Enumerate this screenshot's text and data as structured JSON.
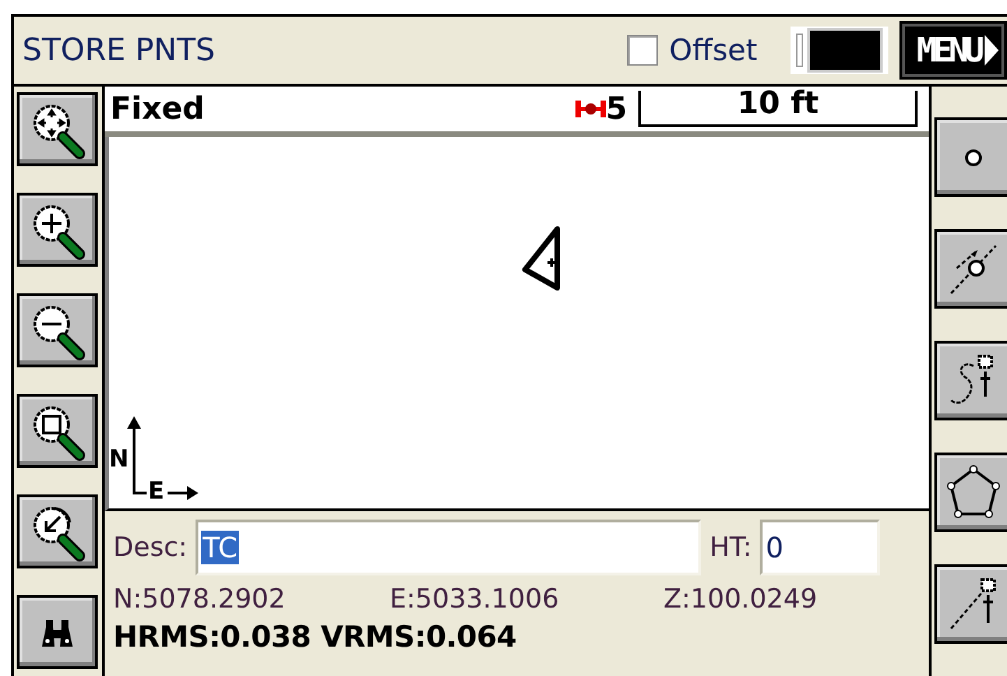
{
  "title": "STORE PNTS",
  "offset": {
    "label": "Offset",
    "checked": false
  },
  "menu_button": "MENU",
  "status": {
    "mode": "Fixed",
    "satellites": "5",
    "scale": "10 ft"
  },
  "map": {
    "compass": {
      "north": "N",
      "east": "E"
    }
  },
  "left_tools": [
    {
      "kind": "zoom-extents"
    },
    {
      "kind": "zoom-in"
    },
    {
      "kind": "zoom-out"
    },
    {
      "kind": "zoom-window"
    },
    {
      "kind": "zoom-previous"
    },
    {
      "kind": "find"
    }
  ],
  "right_tools": [
    {
      "kind": "point"
    },
    {
      "kind": "line"
    },
    {
      "kind": "curve"
    },
    {
      "kind": "polygon"
    },
    {
      "kind": "offset"
    }
  ],
  "desc": {
    "label": "Desc:",
    "value": "TC",
    "selected": true
  },
  "ht": {
    "label": "HT:",
    "value": "0"
  },
  "coords": [
    "N:5078.2902",
    "E:5033.1006",
    "Z:100.0249"
  ],
  "rms": "HRMS:0.038 VRMS:0.064"
}
